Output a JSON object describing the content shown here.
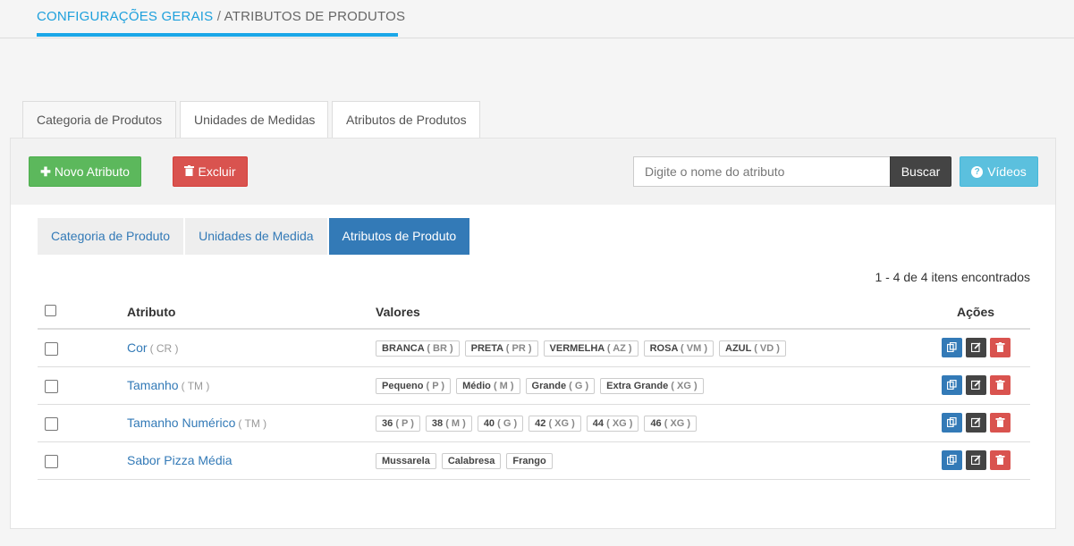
{
  "breadcrumb": {
    "parent": "CONFIGURAÇÕES GERAIS",
    "separator": " / ",
    "current": "ATRIBUTOS DE PRODUTOS"
  },
  "outer_tabs": [
    "Categoria de Produtos",
    "Unidades de Medidas",
    "Atributos de Produtos"
  ],
  "toolbar": {
    "new_label": "Novo Atributo",
    "delete_label": "Excluir",
    "search_placeholder": "Digite o nome do atributo",
    "search_value": "",
    "search_button": "Buscar",
    "videos_label": "Vídeos",
    "new_icon": "plus-icon",
    "delete_icon": "trash-icon",
    "videos_icon": "question-circle-icon"
  },
  "inner_tabs": [
    "Categoria de Produto",
    "Unidades de Medida",
    "Atributos de Produto"
  ],
  "inner_active": 2,
  "result_count": "1 - 4 de 4 itens encontrados",
  "table": {
    "headers": {
      "attribute": "Atributo",
      "values": "Valores",
      "actions": "Ações"
    },
    "rows": [
      {
        "name": "Cor",
        "code": "( CR )",
        "values": [
          {
            "label": "BRANCA",
            "code": "( BR )"
          },
          {
            "label": "PRETA",
            "code": "( PR )"
          },
          {
            "label": "VERMELHA",
            "code": "( AZ )"
          },
          {
            "label": "ROSA",
            "code": "( VM )"
          },
          {
            "label": "AZUL",
            "code": "( VD )"
          }
        ]
      },
      {
        "name": "Tamanho",
        "code": "( TM )",
        "values": [
          {
            "label": "Pequeno",
            "code": "( P )"
          },
          {
            "label": "Médio",
            "code": "( M )"
          },
          {
            "label": "Grande",
            "code": "( G )"
          },
          {
            "label": "Extra Grande",
            "code": "( XG )"
          }
        ]
      },
      {
        "name": "Tamanho Numérico",
        "code": "( TM )",
        "values": [
          {
            "label": "36",
            "code": "( P )"
          },
          {
            "label": "38",
            "code": "( M )"
          },
          {
            "label": "40",
            "code": "( G )"
          },
          {
            "label": "42",
            "code": "( XG )"
          },
          {
            "label": "44",
            "code": "( XG )"
          },
          {
            "label": "46",
            "code": "( XG )"
          }
        ]
      },
      {
        "name": "Sabor Pizza Média",
        "code": "",
        "values": [
          {
            "label": "Mussarela",
            "code": ""
          },
          {
            "label": "Calabresa",
            "code": ""
          },
          {
            "label": "Frango",
            "code": ""
          }
        ]
      }
    ]
  },
  "colors": {
    "accent": "#1aa7e8",
    "primary": "#337ab7",
    "success": "#5cb85c",
    "danger": "#d9534f",
    "info": "#5bc0de",
    "dark": "#444444"
  }
}
